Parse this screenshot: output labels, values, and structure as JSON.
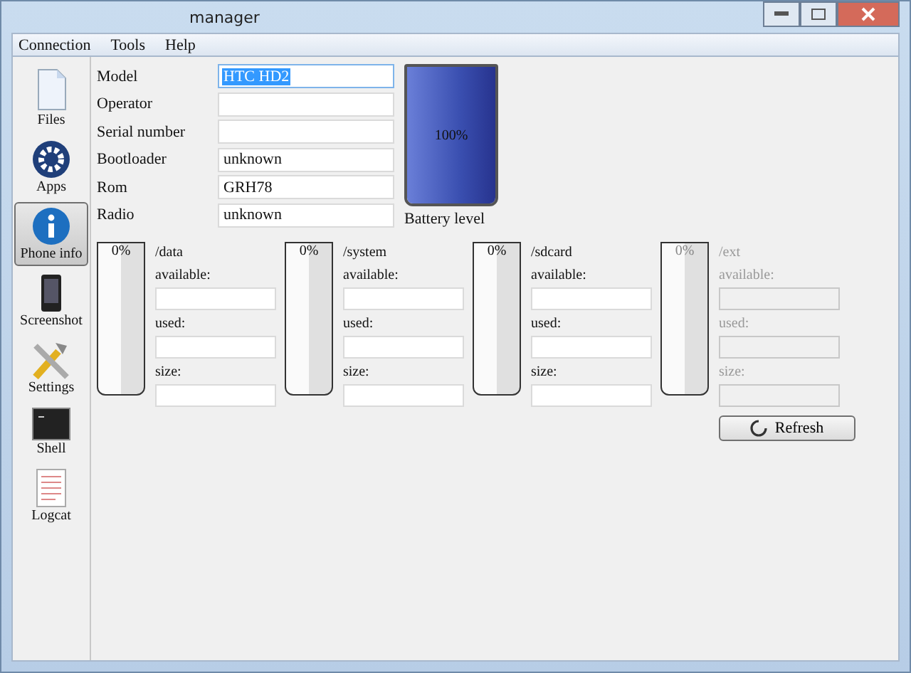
{
  "window": {
    "title": "manager"
  },
  "menu": [
    "Connection",
    "Tools",
    "Help"
  ],
  "sidebar": [
    {
      "label": "Files",
      "kind": "files",
      "selected": false
    },
    {
      "label": "Apps",
      "kind": "apps",
      "selected": false
    },
    {
      "label": "Phone info",
      "kind": "info",
      "selected": true
    },
    {
      "label": "Screenshot",
      "kind": "screenshot",
      "selected": false
    },
    {
      "label": "Settings",
      "kind": "settings",
      "selected": false
    },
    {
      "label": "Shell",
      "kind": "shell",
      "selected": false
    },
    {
      "label": "Logcat",
      "kind": "logcat",
      "selected": false
    }
  ],
  "info": {
    "fields": [
      {
        "label": "Model",
        "value": "HTC HD2",
        "selected": true
      },
      {
        "label": "Operator",
        "selected": false
      },
      {
        "label": "Serial number",
        "selected": false
      },
      {
        "label": "Bootloader",
        "value": "unknown",
        "selected": false
      },
      {
        "label": "Rom",
        "value": "GRH78",
        "selected": false
      },
      {
        "label": "Radio",
        "value": "unknown",
        "selected": false
      }
    ],
    "battery": {
      "level": 1,
      "reading": "100%",
      "label": "Battery level"
    }
  },
  "partitions": [
    {
      "name": "/data",
      "reading": "0%",
      "disabled": false,
      "fields": [
        "available:",
        "used:",
        "size:"
      ]
    },
    {
      "name": "/system",
      "reading": "0%",
      "disabled": false,
      "fields": [
        "available:",
        "used:",
        "size:"
      ]
    },
    {
      "name": "/sdcard",
      "reading": "0%",
      "disabled": false,
      "fields": [
        "available:",
        "used:",
        "size:"
      ]
    },
    {
      "name": "/ext",
      "reading": "0%",
      "disabled": true,
      "fields": [
        "available:",
        "used:",
        "size:"
      ]
    }
  ],
  "refresh": "Refresh"
}
